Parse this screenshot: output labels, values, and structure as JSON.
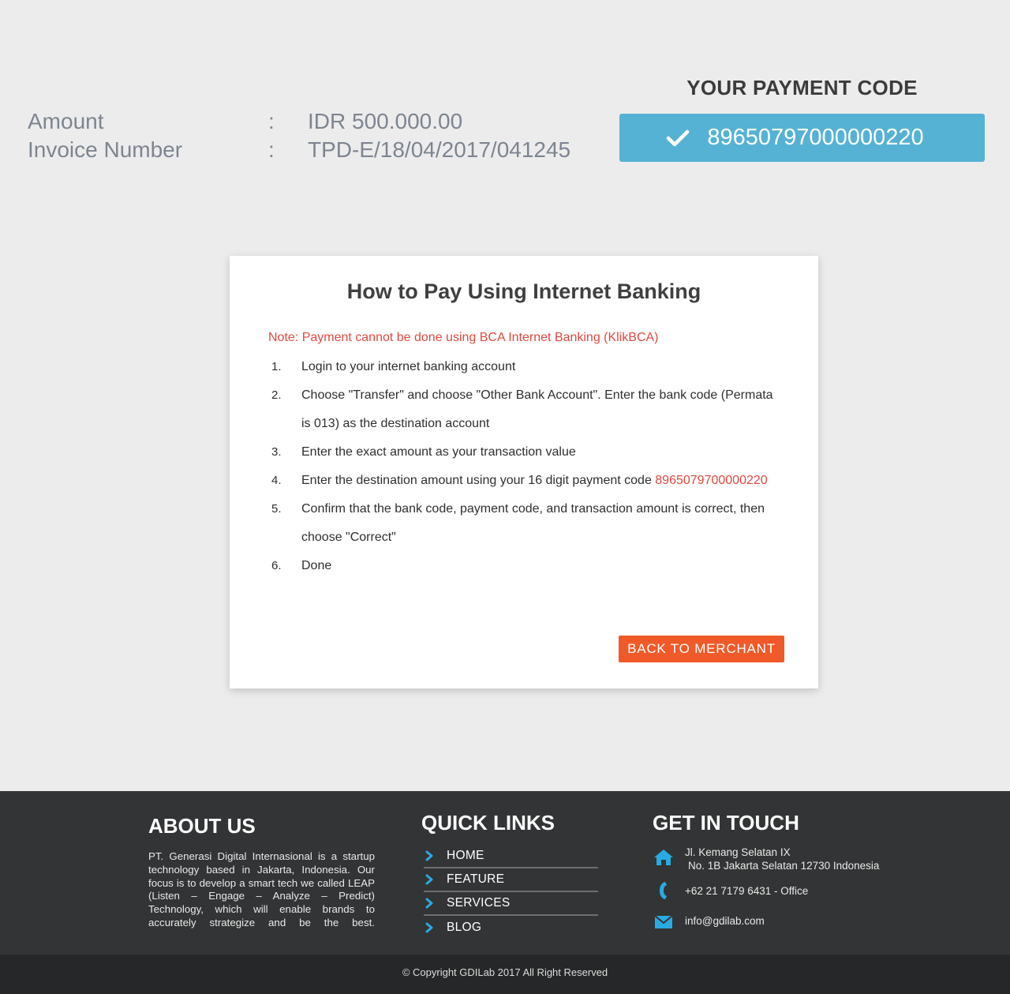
{
  "summary": {
    "amount_label": "Amount",
    "amount_value": "IDR 500.000.00",
    "invoice_label": "Invoice Number",
    "invoice_value": "TPD-E/18/04/2017/041245",
    "separator": ":"
  },
  "payment_code": {
    "title": "YOUR PAYMENT CODE",
    "code": "89650797000000220",
    "icon": "check-icon",
    "color": "#55b2d4"
  },
  "card": {
    "title": "How to Pay Using Internet Banking",
    "note": "Note: Payment cannot be done using BCA Internet Banking (KlikBCA)",
    "steps": [
      {
        "num": "1.",
        "text": "Login to your internet banking account"
      },
      {
        "num": "2.",
        "text": "Choose \"Transfer\" and choose \"Other Bank Account\".  Enter the bank code (Permata is 013) as the destination account"
      },
      {
        "num": "3.",
        "text": "Enter the exact amount as your transaction value"
      },
      {
        "num": "4.",
        "text": "Enter the destination amount using your 16 digit payment code ",
        "code": "8965079700000220"
      },
      {
        "num": "5.",
        "text": "Confirm that the bank code, payment code, and transaction amount is correct, then choose \"Correct\""
      },
      {
        "num": "6.",
        "text": "Done"
      }
    ],
    "back_button": "BACK TO MERCHANT",
    "accent_color": "#f05a28",
    "note_color": "#e0493f"
  },
  "footer": {
    "about": {
      "heading": "ABOUT US",
      "text": "PT. Generasi Digital Internasional is a startup technology based in Jakarta, Indonesia. Our focus is to develop a smart tech we called LEAP (Listen – Engage – Analyze – Predict) Technology, which will enable brands to accurately strategize and be the best."
    },
    "quick_links": {
      "heading": "QUICK LINKS",
      "items": [
        "HOME",
        "FEATURE",
        "SERVICES",
        "BLOG"
      ]
    },
    "get_in_touch": {
      "heading": "GET IN TOUCH",
      "address_line1": "Jl. Kemang Selatan IX",
      "address_line2": "No. 1B Jakarta Selatan 12730 Indonesia",
      "phone": "+62 21 7179 6431 - Office",
      "email": "info@gdilab.com",
      "icon_color": "#29abe2"
    },
    "copyright": "© Copyright GDILab 2017 All Right Reserved"
  }
}
